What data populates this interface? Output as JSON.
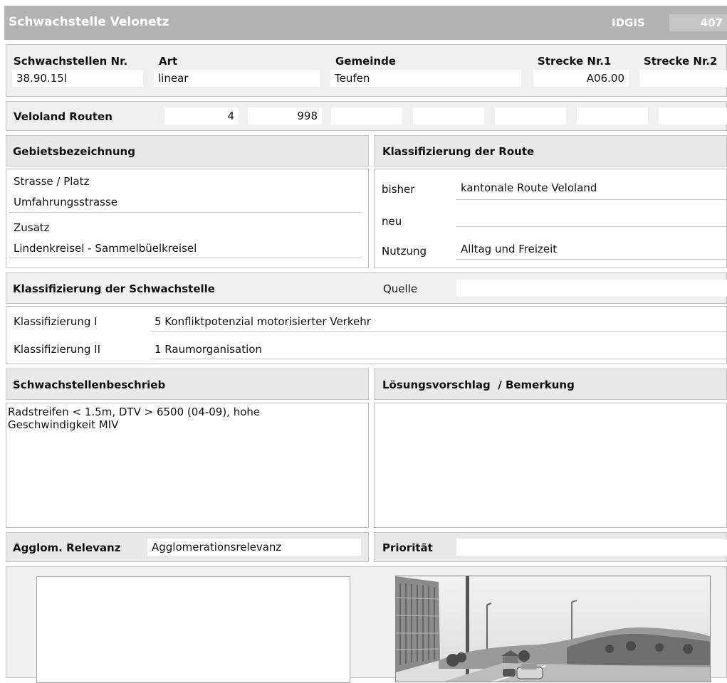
{
  "title": {
    "text": "Schwachstelle Velonetz",
    "idgis_label": "IDGIS",
    "idgis_value": "407"
  },
  "row1": {
    "nr_label": "Schwachstellen Nr.",
    "nr_value": "38.90.15l",
    "art_label": "Art",
    "art_value": "linear",
    "gemeinde_label": "Gemeinde",
    "gemeinde_value": "Teufen",
    "strecke1_label": "Strecke Nr.1",
    "strecke1_value": "A06.00",
    "strecke2_label": "Strecke Nr.2",
    "strecke2_value": ""
  },
  "veloland": {
    "label": "Veloland Routen",
    "values": [
      "4",
      "998",
      "",
      "",
      "",
      "",
      ""
    ]
  },
  "gebiet": {
    "header": "Gebietsbezeichnung",
    "strasse_label": "Strasse / Platz",
    "strasse_value": "Umfahrungsstrasse",
    "zusatz_label": "Zusatz",
    "zusatz_value": "Lindenkreisel - Sammelbüelkreisel"
  },
  "klass_route": {
    "header": "Klassifizierung der Route",
    "bisher_label": "bisher",
    "bisher_value": "kantonale Route Veloland",
    "neu_label": "neu",
    "neu_value": "",
    "nutzung_label": "Nutzung",
    "nutzung_value": "Alltag und Freizeit"
  },
  "klass_schwach": {
    "header": "Klassifizierung der Schwachstelle",
    "quelle_label": "Quelle",
    "quelle_value": "",
    "k1_label": "Klassifizierung I",
    "k1_value": "5 Konfliktpotenzial motorisierter Verkehr",
    "k2_label": "Klassifizierung II",
    "k2_value": "1 Raumorganisation"
  },
  "beschrieb": {
    "header": "Schwachstellenbeschrieb",
    "line1": "Radstreifen < 1.5m, DTV > 6500 (04-09), hohe",
    "line2": "Geschwindigkeit MIV"
  },
  "loesung": {
    "header": "Lösungsvorschlag  / Bemerkung",
    "value": ""
  },
  "agglom": {
    "label": "Agglom. Relevanz",
    "value": "Agglomerationsrelevanz"
  },
  "prioritaet": {
    "label": "Priorität",
    "value": ""
  },
  "colors": {
    "title_bar": "#b3b3b3",
    "panel_bg": "#f0f0f0",
    "field_bg": "#ffffff",
    "border": "#bdbdbd"
  }
}
